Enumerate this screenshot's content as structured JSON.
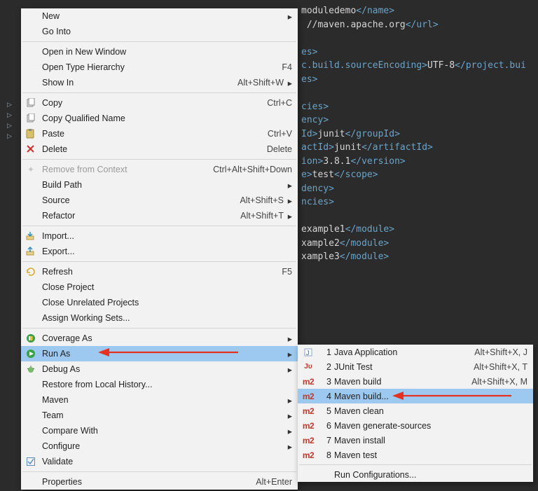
{
  "code": {
    "line1_a": "moduledemo",
    "line1_b": "name",
    "line2_a": "//maven.apache.org",
    "line2_b": "url",
    "line3_a": "es",
    "line4_a": "c.build.sourceEncoding",
    "line4_b": "UTF-8",
    "line4_c": "project.bui",
    "line5_a": "es",
    "line6_a": "cies",
    "line7_a": "ency",
    "line8_a": "Id",
    "line8_b": "junit",
    "line8_c": "groupId",
    "line9_a": "actId",
    "line9_b": "junit",
    "line9_c": "artifactId",
    "line10_a": "ion",
    "line10_b": "3.8.1",
    "line10_c": "version",
    "line11_a": "e",
    "line11_b": "test",
    "line11_c": "scope",
    "line12_a": "dency",
    "line13_a": "ncies",
    "line14_a": "example1",
    "line14_b": "module",
    "line15_a": "xample2",
    "line15_b": "module",
    "line16_a": "xample3",
    "line16_b": "module"
  },
  "menu": {
    "new": "New",
    "goInto": "Go Into",
    "openNewWindow": "Open in New Window",
    "openTypeHier": "Open Type Hierarchy",
    "openTypeHier_k": "F4",
    "showIn": "Show In",
    "showIn_k": "Alt+Shift+W",
    "copy": "Copy",
    "copy_k": "Ctrl+C",
    "copyQName": "Copy Qualified Name",
    "paste": "Paste",
    "paste_k": "Ctrl+V",
    "delete": "Delete",
    "delete_k": "Delete",
    "removeCtx": "Remove from Context",
    "removeCtx_k": "Ctrl+Alt+Shift+Down",
    "buildPath": "Build Path",
    "source": "Source",
    "source_k": "Alt+Shift+S",
    "refactor": "Refactor",
    "refactor_k": "Alt+Shift+T",
    "import": "Import...",
    "export": "Export...",
    "refresh": "Refresh",
    "refresh_k": "F5",
    "closeProj": "Close Project",
    "closeUnrel": "Close Unrelated Projects",
    "assignWS": "Assign Working Sets...",
    "coverageAs": "Coverage As",
    "runAs": "Run As",
    "debugAs": "Debug As",
    "restoreHist": "Restore from Local History...",
    "maven": "Maven",
    "team": "Team",
    "compareWith": "Compare With",
    "configure": "Configure",
    "validate": "Validate",
    "properties": "Properties",
    "properties_k": "Alt+Enter"
  },
  "submenu": {
    "javaApp": {
      "n": "1",
      "label": "Java Application",
      "k": "Alt+Shift+X, J"
    },
    "junit": {
      "n": "2",
      "label": "JUnit Test",
      "k": "Alt+Shift+X, T"
    },
    "mvnBuild": {
      "n": "3",
      "label": "Maven build",
      "k": "Alt+Shift+X, M"
    },
    "mvnBuildE": {
      "n": "4",
      "label": "Maven build..."
    },
    "mvnClean": {
      "n": "5",
      "label": "Maven clean"
    },
    "mvnGenSrc": {
      "n": "6",
      "label": "Maven generate-sources"
    },
    "mvnInstall": {
      "n": "7",
      "label": "Maven install"
    },
    "mvnTest": {
      "n": "8",
      "label": "Maven test"
    },
    "runConfigs": "Run Configurations..."
  }
}
